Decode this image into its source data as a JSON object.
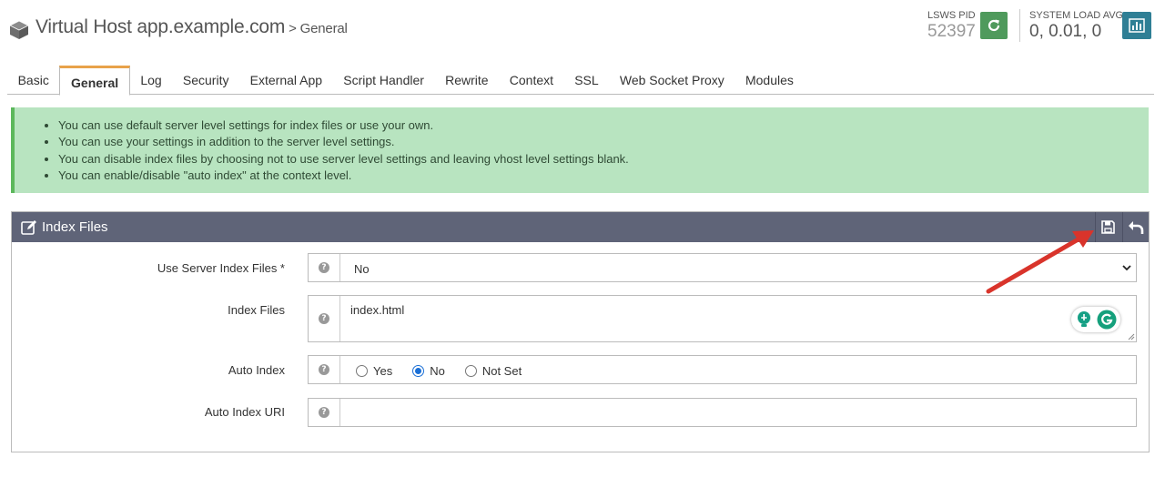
{
  "header": {
    "title": "Virtual Host app.example.com",
    "subtitle": "> General",
    "pid_label": "LSWS PID",
    "pid_value": "52397",
    "load_label": "SYSTEM LOAD AVG",
    "load_value": "0, 0.01, 0",
    "icons": {
      "logo": "cube-icon",
      "restart": "refresh-icon",
      "stats": "bar-chart-icon"
    },
    "colors": {
      "restart_button": "#4f9a5c",
      "stats_button": "#2f7f95"
    }
  },
  "tabs": [
    {
      "label": "Basic",
      "active": false
    },
    {
      "label": "General",
      "active": true
    },
    {
      "label": "Log",
      "active": false
    },
    {
      "label": "Security",
      "active": false
    },
    {
      "label": "External App",
      "active": false
    },
    {
      "label": "Script Handler",
      "active": false
    },
    {
      "label": "Rewrite",
      "active": false
    },
    {
      "label": "Context",
      "active": false
    },
    {
      "label": "SSL",
      "active": false
    },
    {
      "label": "Web Socket Proxy",
      "active": false
    },
    {
      "label": "Modules",
      "active": false
    }
  ],
  "info": {
    "items": [
      "You can use default server level settings for index files or use your own.",
      "You can use your settings in addition to the server level settings.",
      "You can disable index files by choosing not to use server level settings and leaving vhost level settings blank.",
      "You can enable/disable \"auto index\" at the context level."
    ],
    "colors": {
      "background": "#b8e4c0",
      "border": "#5cb85c"
    }
  },
  "panel": {
    "title": "Index Files",
    "header_color": "#5f6478",
    "icons": {
      "edit": "edit-icon",
      "save": "save-icon",
      "undo": "undo-icon"
    },
    "fields": {
      "use_server": {
        "label": "Use Server Index Files *",
        "value": "No"
      },
      "index_files": {
        "label": "Index Files",
        "value": "index.html"
      },
      "auto_index": {
        "label": "Auto Index",
        "options": [
          {
            "label": "Yes",
            "checked": false
          },
          {
            "label": "No",
            "checked": true
          },
          {
            "label": "Not Set",
            "checked": false
          }
        ]
      },
      "auto_index_uri": {
        "label": "Auto Index URI",
        "value": ""
      }
    }
  },
  "annotation": {
    "color": "#d9342b",
    "icon": "arrow-annotation"
  }
}
